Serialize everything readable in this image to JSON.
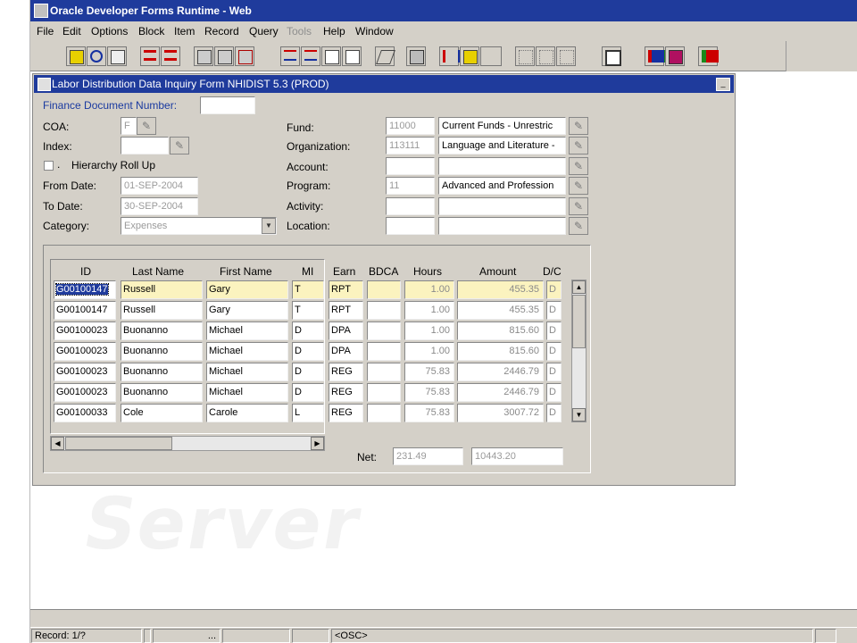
{
  "app": {
    "title": "Oracle Developer Forms Runtime - Web"
  },
  "menu": [
    "File",
    "Edit",
    "Options",
    "Block",
    "Item",
    "Record",
    "Query",
    "Tools",
    "Help",
    "Window"
  ],
  "form": {
    "title": "Labor Distribution Data Inquiry Form  NHIDIST  5.3  (PROD)",
    "finance_doc_label": "Finance Document Number:",
    "finance_doc_value": "",
    "coa_label": "COA:",
    "coa_value": "F",
    "index_label": "Index:",
    "index_value": "",
    "hierarchy_label": "Hierarchy Roll Up",
    "hierarchy_dot": ".",
    "from_date_label": "From Date:",
    "from_date_value": "01-SEP-2004",
    "to_date_label": "To Date:",
    "to_date_value": "30-SEP-2004",
    "category_label": "Category:",
    "category_value": "Expenses",
    "fund_label": "Fund:",
    "fund_code": "11000",
    "fund_desc": "Current Funds - Unrestric",
    "org_label": "Organization:",
    "org_code": "113111",
    "org_desc": "Language and Literature -",
    "account_label": "Account:",
    "account_code": "",
    "account_desc": "",
    "program_label": "Program:",
    "program_code": "11",
    "program_desc": "Advanced and Profession",
    "activity_label": "Activity:",
    "activity_code": "",
    "activity_desc": "",
    "location_label": "Location:",
    "location_code": "",
    "location_desc": ""
  },
  "grid": {
    "headers": {
      "id": "ID",
      "last": "Last Name",
      "first": "First Name",
      "mi": "MI",
      "earn": "Earn",
      "bdca": "BDCA",
      "hours": "Hours",
      "amount": "Amount",
      "dc": "D/C"
    },
    "rows": [
      {
        "id": "G00100147",
        "last": "Russell",
        "first": "Gary",
        "mi": "T",
        "earn": "RPT",
        "bdca": "",
        "hours": "1.00",
        "amount": "455.35",
        "dc": "D"
      },
      {
        "id": "G00100147",
        "last": "Russell",
        "first": "Gary",
        "mi": "T",
        "earn": "RPT",
        "bdca": "",
        "hours": "1.00",
        "amount": "455.35",
        "dc": "D"
      },
      {
        "id": "G00100023",
        "last": "Buonanno",
        "first": "Michael",
        "mi": "D",
        "earn": "DPA",
        "bdca": "",
        "hours": "1.00",
        "amount": "815.60",
        "dc": "D"
      },
      {
        "id": "G00100023",
        "last": "Buonanno",
        "first": "Michael",
        "mi": "D",
        "earn": "DPA",
        "bdca": "",
        "hours": "1.00",
        "amount": "815.60",
        "dc": "D"
      },
      {
        "id": "G00100023",
        "last": "Buonanno",
        "first": "Michael",
        "mi": "D",
        "earn": "REG",
        "bdca": "",
        "hours": "75.83",
        "amount": "2446.79",
        "dc": "D"
      },
      {
        "id": "G00100023",
        "last": "Buonanno",
        "first": "Michael",
        "mi": "D",
        "earn": "REG",
        "bdca": "",
        "hours": "75.83",
        "amount": "2446.79",
        "dc": "D"
      },
      {
        "id": "G00100033",
        "last": "Cole",
        "first": "Carole",
        "mi": "L",
        "earn": "REG",
        "bdca": "",
        "hours": "75.83",
        "amount": "3007.72",
        "dc": "D"
      }
    ],
    "net_label": "Net:",
    "net_hours": "231.49",
    "net_amount": "10443.20"
  },
  "status": {
    "record": "Record: 1/?",
    "ellipsis": "...",
    "osc": "<OSC>"
  },
  "watermark": "Server"
}
